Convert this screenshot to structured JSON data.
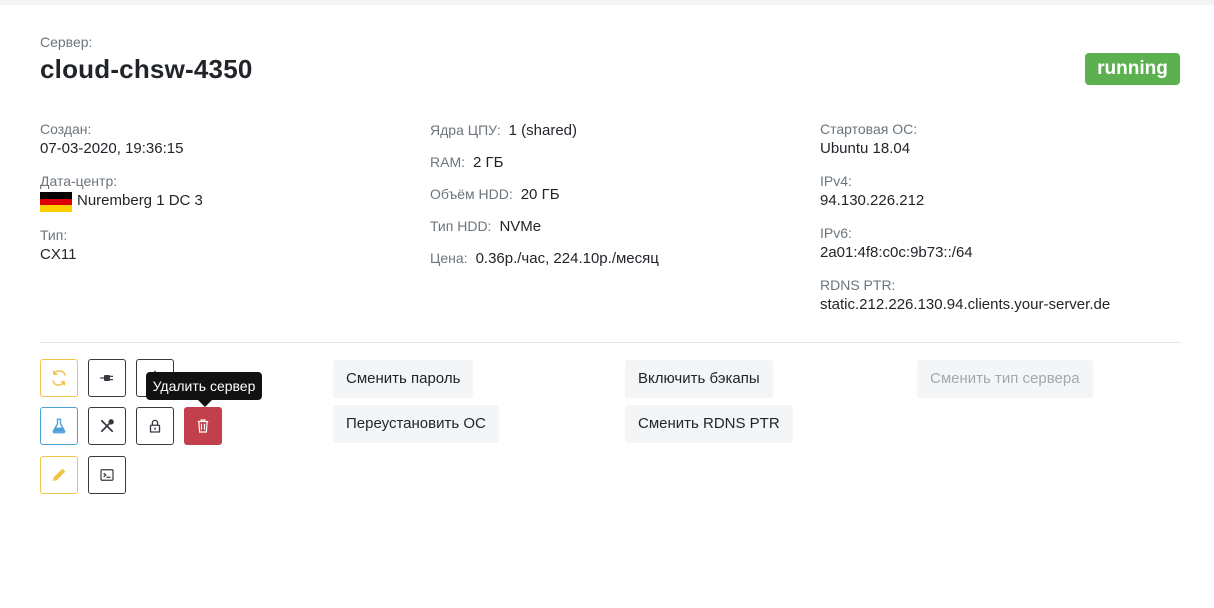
{
  "header": {
    "label": "Сервер:",
    "server_name": "cloud-chsw-4350",
    "status": "running",
    "status_color": "#5cb04f"
  },
  "left_info": {
    "created_label": "Создан:",
    "created_value": "07-03-2020, 19:36:15",
    "datacenter_label": "Дата-центр:",
    "datacenter_value": "Nuremberg 1 DC 3",
    "datacenter_flag": "germany-flag",
    "type_label": "Тип:",
    "type_value": "CX11"
  },
  "middle_info": {
    "cpu_label": "Ядра ЦПУ:",
    "cpu_value": "1 (shared)",
    "ram_label": "RAM:",
    "ram_value": "2 ГБ",
    "hdd_label": "Объём HDD:",
    "hdd_value": "20 ГБ",
    "hdd_type_label": "Тип HDD:",
    "hdd_type_value": "NVMe",
    "price_label": "Цена:",
    "price_value": "0.36р./час, 224.10р./месяц"
  },
  "right_info": {
    "os_label": "Стартовая ОС:",
    "os_value": "Ubuntu 18.04",
    "ipv4_label": "IPv4:",
    "ipv4_value": "94.130.226.212",
    "ipv6_label": "IPv6:",
    "ipv6_value": "2a01:4f8:c0c:9b73::/64",
    "rdns_label": "RDNS PTR:",
    "rdns_value": "static.212.226.130.94.clients.your-server.de"
  },
  "icon_buttons": [
    {
      "name": "restart-icon",
      "color": "#f0c34a"
    },
    {
      "name": "plug-icon",
      "color": "#343a40"
    },
    {
      "name": "power-icon",
      "color": "#343a40"
    },
    {
      "name": "flask-icon",
      "color": "#4a9fd6"
    },
    {
      "name": "tools-icon",
      "color": "#343a40"
    },
    {
      "name": "lock-icon",
      "color": "#343a40"
    },
    {
      "name": "trash-icon",
      "color": "#c1404b"
    },
    {
      "name": "pencil-icon",
      "color": "#f0c34a"
    },
    {
      "name": "terminal-icon",
      "color": "#343a40"
    }
  ],
  "tooltip": {
    "text": "Удалить сервер"
  },
  "actions": {
    "change_password": "Сменить пароль",
    "reinstall_os": "Переустановить ОС",
    "enable_backups": "Включить бэкапы",
    "change_rdns": "Сменить RDNS PTR",
    "change_type": "Сменить тип сервера"
  }
}
